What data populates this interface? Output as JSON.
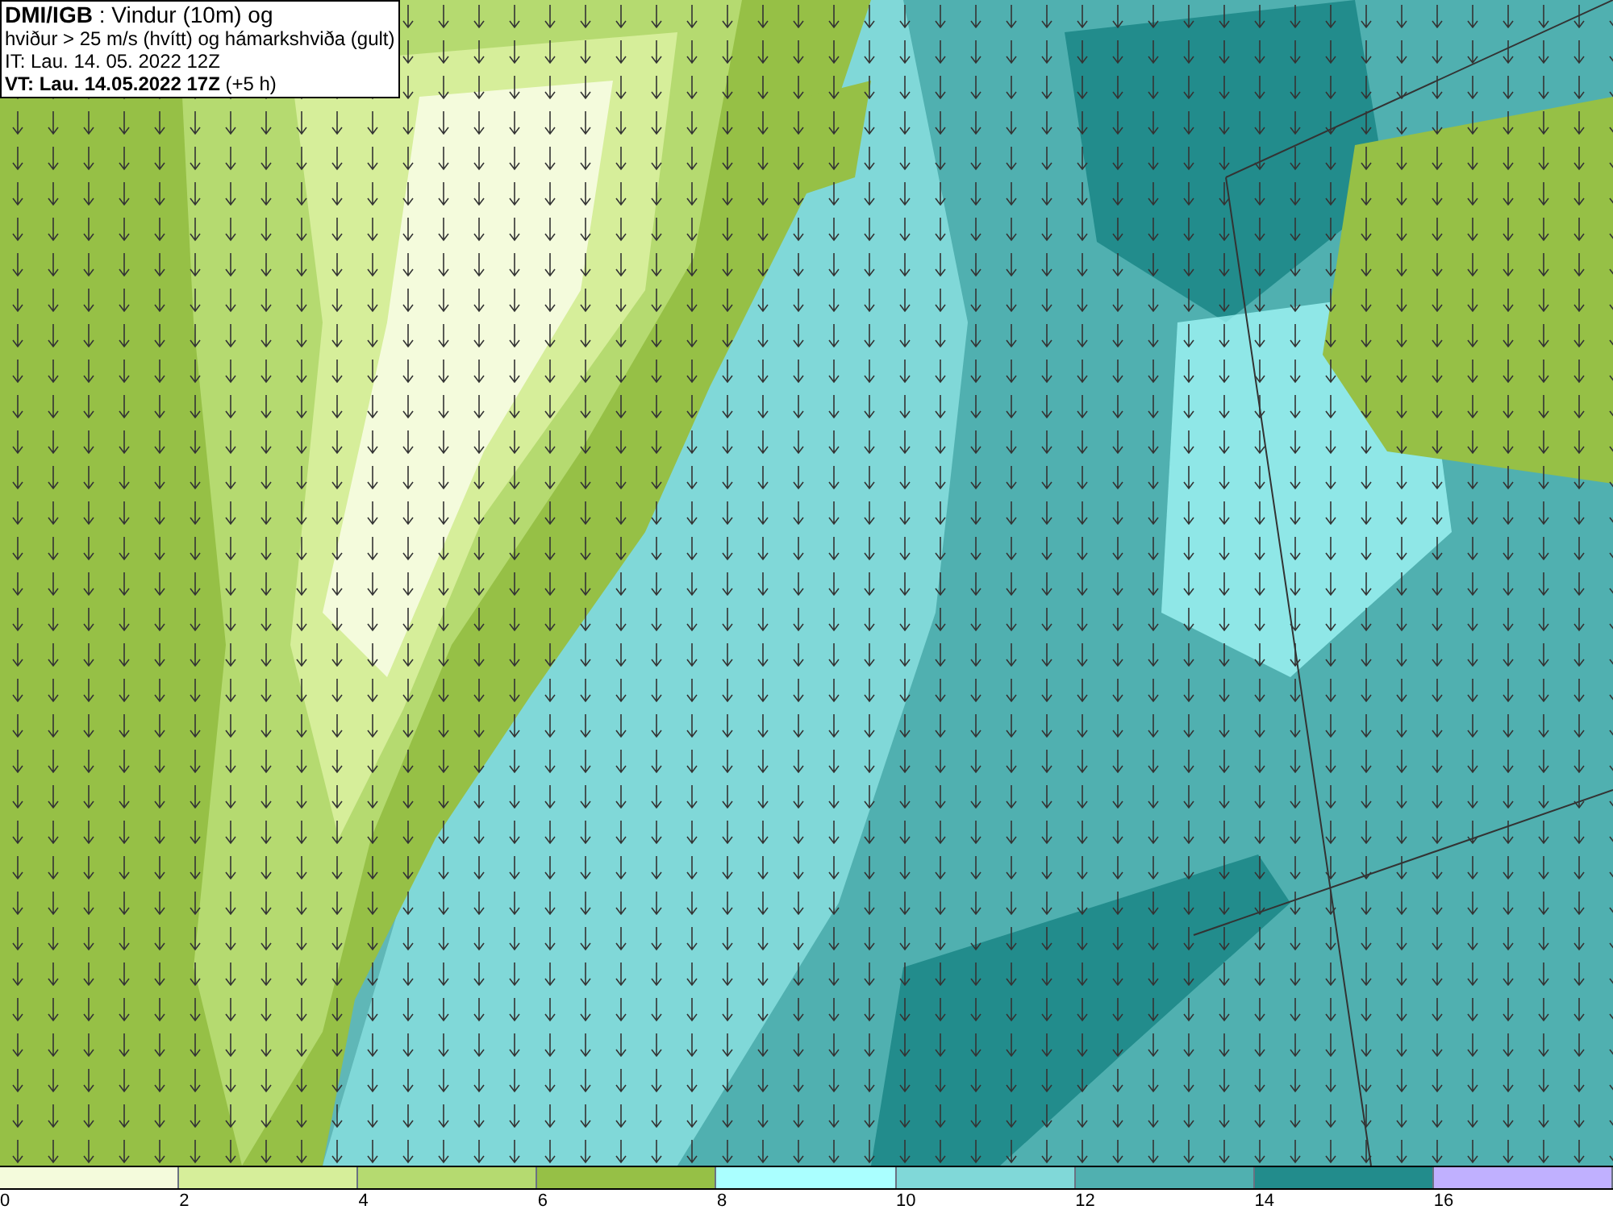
{
  "title_box": {
    "lines": [
      "**DMI/IGB** : Vindur (10m) og",
      "hviður > 25 m/s (hvítt) og hámarkshviða (gult)",
      "IT: Lau. 14. 05. 2022 12Z",
      "**VT: Lau. 14.05.2022 17Z** (+5 h)"
    ]
  },
  "legend": {
    "segments": [
      {
        "color": "#f4fbdc"
      },
      {
        "color": "#d6ee9a"
      },
      {
        "color": "#b5da70"
      },
      {
        "color": "#96c046"
      },
      {
        "color": "#aaffff"
      },
      {
        "color": "#80d8d8"
      },
      {
        "color": "#50b0b0"
      },
      {
        "color": "#228c8c"
      },
      {
        "color": "#c0b0ff"
      }
    ],
    "ticks": [
      "0",
      "2",
      "4",
      "6",
      "8",
      "10",
      "12",
      "14",
      "16"
    ]
  }
}
